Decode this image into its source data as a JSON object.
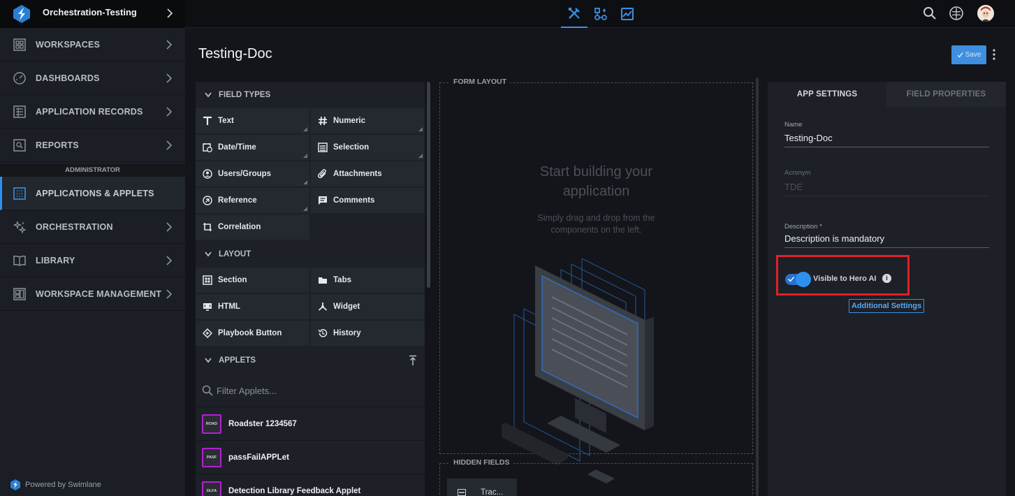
{
  "topbar": {
    "workspace_name": "Orchestration-Testing",
    "icons": [
      "builder-tools-icon",
      "workflow-icon",
      "image-chart-icon"
    ],
    "right_icons": [
      "search-icon",
      "brain-icon",
      "user-avatar"
    ]
  },
  "sidebar": {
    "items": [
      {
        "label": "WORKSPACES",
        "icon": "workspaces-icon"
      },
      {
        "label": "DASHBOARDS",
        "icon": "dashboard-gauge-icon"
      },
      {
        "label": "APPLICATION RECORDS",
        "icon": "records-icon"
      },
      {
        "label": "REPORTS",
        "icon": "reports-icon"
      },
      {
        "label": "APPLICATIONS & APPLETS",
        "icon": "applications-grid-icon"
      },
      {
        "label": "ORCHESTRATION",
        "icon": "sparkles-icon"
      },
      {
        "label": "LIBRARY",
        "icon": "library-book-icon"
      },
      {
        "label": "WORKSPACE MANAGEMENT",
        "icon": "workspace-management-icon"
      }
    ],
    "admin_header": "ADMINISTRATOR",
    "powered_by": "Powered by Swimlane"
  },
  "page": {
    "title": "Testing-Doc",
    "save_label": "Save"
  },
  "palette": {
    "field_types_title": "FIELD TYPES",
    "field_types": [
      "Text",
      "Numeric",
      "Date/Time",
      "Selection",
      "Users/Groups",
      "Attachments",
      "Reference",
      "Comments",
      "Correlation"
    ],
    "layout_title": "LAYOUT",
    "layout_items": [
      "Section",
      "Tabs",
      "HTML",
      "Widget",
      "Playbook Button",
      "History"
    ],
    "applets_title": "APPLETS",
    "filter_placeholder": "Filter Applets...",
    "applets": [
      {
        "badge": "ROAD",
        "label": "Roadster 1234567"
      },
      {
        "badge": "PASF",
        "label": "passFailAPPLet"
      },
      {
        "badge": "DLFA",
        "label": "Detection Library Feedback Applet"
      }
    ]
  },
  "form_layout": {
    "legend": "FORM LAYOUT",
    "heading_line1": "Start building your",
    "heading_line2": "application",
    "sub_line1": "Simply drag and drop from the",
    "sub_line2": "components on the left."
  },
  "hidden_fields": {
    "legend": "HIDDEN FIELDS",
    "item_label": "Trac..."
  },
  "settings": {
    "tab_app": "APP SETTINGS",
    "tab_field": "FIELD PROPERTIES",
    "name_label": "Name",
    "name_value": "Testing-Doc",
    "acronym_label": "Acronym",
    "acronym_value": "TDE",
    "description_label": "Description *",
    "description_value": "Description is mandatory",
    "toggle_label": "Visible to Hero AI",
    "toggle_on": true,
    "additional_settings": "Additional Settings"
  },
  "colors": {
    "accent": "#3b8fe4",
    "highlight_box": "#e0202a",
    "applet_badge_border": "#b61fd6"
  }
}
